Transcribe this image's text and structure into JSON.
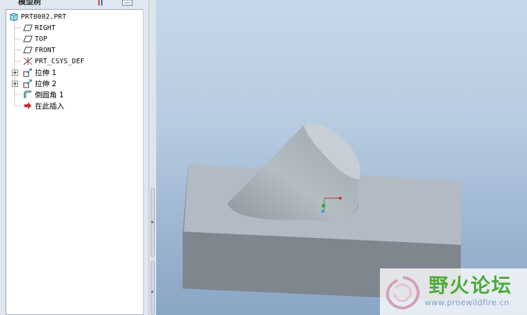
{
  "panel": {
    "title": "模型树",
    "toolbar_icons": [
      "settings-icon",
      "list-icon"
    ]
  },
  "tree": {
    "root": {
      "label": "PRT0002.PRT",
      "icon": "part-icon"
    },
    "items": [
      {
        "label": "RIGHT",
        "icon": "datum-plane-icon",
        "expandable": false
      },
      {
        "label": "TOP",
        "icon": "datum-plane-icon",
        "expandable": false
      },
      {
        "label": "FRONT",
        "icon": "datum-plane-icon",
        "expandable": false
      },
      {
        "label": "PRT_CSYS_DEF",
        "icon": "coordinate-system-icon",
        "expandable": false
      },
      {
        "label": "拉伸 1",
        "icon": "extrude-icon",
        "expandable": true
      },
      {
        "label": "拉伸 2",
        "icon": "extrude-icon",
        "expandable": true
      },
      {
        "label": "倒圆角 1",
        "icon": "round-icon",
        "expandable": false
      },
      {
        "label": "在此插入",
        "icon": "insert-here-arrow-icon",
        "expandable": false
      }
    ]
  },
  "viewport": {
    "background_top": "#c6d7ea",
    "background_bottom": "#8aa6c5",
    "model_colors": {
      "top_face": "#b2bbc4",
      "front_face": "#7e868e",
      "cylinder": "#a9b1b8",
      "cut": "#9aa2aa"
    }
  },
  "watermark": {
    "title": "野火论坛",
    "url": "www.proewildfire.cn",
    "brand_color": "#4dab3a"
  }
}
